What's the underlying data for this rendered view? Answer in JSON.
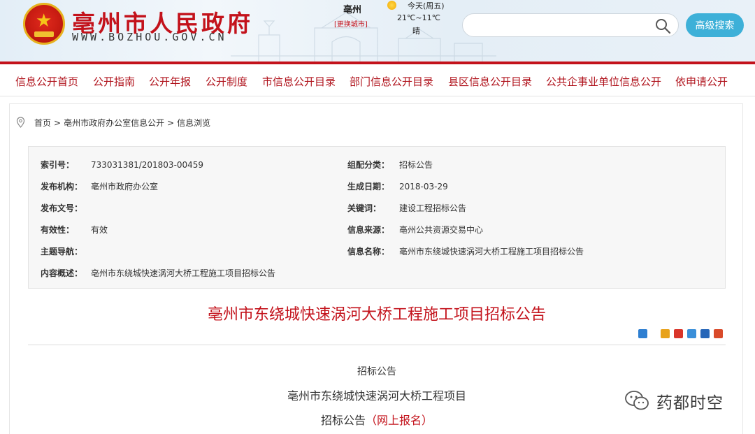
{
  "header": {
    "site_title": "亳州市人民政府",
    "site_url": "WWW.BOZHOU.GOV.CN",
    "city": "亳州",
    "change_city": "[更换城市]",
    "weather_day": "今天(周五)",
    "weather_temp": "21℃~11℃",
    "weather_condition": "晴",
    "search_placeholder": "",
    "advanced_search": "高级搜索"
  },
  "nav": {
    "items": [
      "信息公开首页",
      "公开指南",
      "公开年报",
      "公开制度",
      "市信息公开目录",
      "部门信息公开目录",
      "县区信息公开目录",
      "公共企事业单位信息公开",
      "依申请公开"
    ]
  },
  "breadcrumb": [
    "首页",
    "亳州市政府办公室信息公开",
    "信息浏览"
  ],
  "breadcrumb_sep": ">",
  "meta": {
    "left": [
      {
        "label": "索引号：",
        "value": "733031381/201803-00459"
      },
      {
        "label": "发布机构：",
        "value": "亳州市政府办公室"
      },
      {
        "label": "发布文号：",
        "value": ""
      },
      {
        "label": "有效性：",
        "value": "有效"
      },
      {
        "label": "主题导航：",
        "value": ""
      },
      {
        "label": "内容概述：",
        "value": "亳州市东绕城快速涡河大桥工程施工项目招标公告"
      }
    ],
    "right": [
      {
        "label": "组配分类：",
        "value": "招标公告"
      },
      {
        "label": "生成日期：",
        "value": "2018-03-29"
      },
      {
        "label": "关键词：",
        "value": "建设工程招标公告"
      },
      {
        "label": "信息来源：",
        "value": "亳州公共资源交易中心"
      },
      {
        "label": "信息名称：",
        "value": "亳州市东绕城快速涡河大桥工程施工项目招标公告"
      }
    ]
  },
  "document": {
    "title": "亳州市东绕城快速涡河大桥工程施工项目招标公告",
    "line1": "招标公告",
    "line2": "亳州市东绕城快速涡河大桥工程项目",
    "line3_prefix": "招标公告",
    "line3_highlight": "（网上报名）"
  },
  "watermark": "药都时空",
  "colors": {
    "brand_red": "#c3121b",
    "button_blue": "#3db0d8",
    "meta_bg": "#f7f7f7"
  }
}
